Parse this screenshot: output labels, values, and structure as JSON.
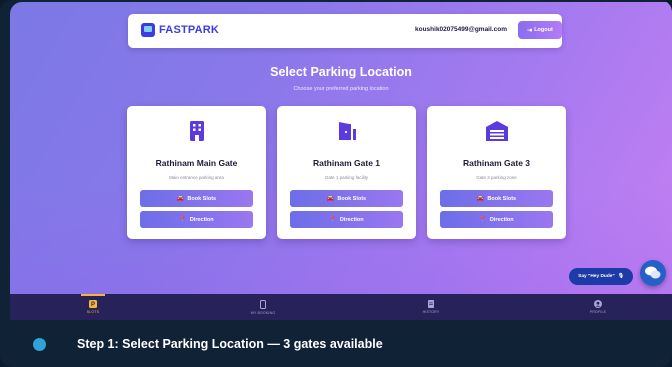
{
  "header": {
    "brand": "FASTPARK",
    "email": "koushik02075499@gmail.com",
    "logout_label": "Logout"
  },
  "page": {
    "title": "Select Parking Location",
    "subtitle": "Choose your preferred parking location"
  },
  "locations": [
    {
      "name": "Rathinam Main Gate",
      "description": "Main entrance parking area",
      "book_label": "Book Slots",
      "direction_label": "Direction",
      "icon": "building-icon"
    },
    {
      "name": "Rathinam Gate 1",
      "description": "Gate 1 parking facility",
      "book_label": "Book Slots",
      "direction_label": "Direction",
      "icon": "door-icon"
    },
    {
      "name": "Rathinam Gate 3",
      "description": "Gate 3 parking zone",
      "book_label": "Book Slots",
      "direction_label": "Direction",
      "icon": "garage-icon"
    }
  ],
  "assistant": {
    "prompt": "Say \"Hey Dude\""
  },
  "nav": [
    {
      "label": "SLOTS",
      "icon": "parking-icon",
      "active": true
    },
    {
      "label": "MY BOOKING",
      "icon": "phone-icon",
      "active": false
    },
    {
      "label": "HISTORY",
      "icon": "document-icon",
      "active": false
    },
    {
      "label": "PROFILE",
      "icon": "user-icon",
      "active": false
    }
  ],
  "caption": {
    "text": "Step 1: Select Parking Location — 3 gates available"
  },
  "colors": {
    "brand": "#3d3be3",
    "accent_orange": "#f5b53b",
    "button_gradient_start": "#6c6ee8",
    "button_gradient_end": "#9a77f0",
    "icon_purple": "#5b3be0"
  }
}
